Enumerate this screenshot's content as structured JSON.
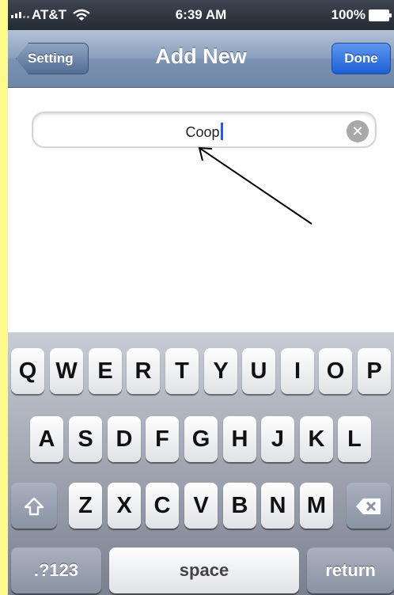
{
  "status_bar": {
    "carrier": "AT&T",
    "time": "6:39 AM",
    "battery": "100%"
  },
  "nav": {
    "title": "Add New",
    "back_label": "Setting",
    "done_label": "Done"
  },
  "field": {
    "value": "Coop",
    "clear_symbol": "✕"
  },
  "keyboard": {
    "row1": [
      "Q",
      "W",
      "E",
      "R",
      "T",
      "Y",
      "U",
      "I",
      "O",
      "P"
    ],
    "row2": [
      "A",
      "S",
      "D",
      "F",
      "G",
      "H",
      "J",
      "K",
      "L"
    ],
    "row3": [
      "Z",
      "X",
      "C",
      "V",
      "B",
      "N",
      "M"
    ],
    "numbers_label": ".?123",
    "space_label": "space",
    "return_label": "return",
    "shift_icon": "shift-icon",
    "delete_icon": "delete-icon"
  },
  "colors": {
    "page_background": "#fdf98a",
    "done_button": "#1d5fd6",
    "cursor": "#2a58e8",
    "arrow": "#000000"
  }
}
